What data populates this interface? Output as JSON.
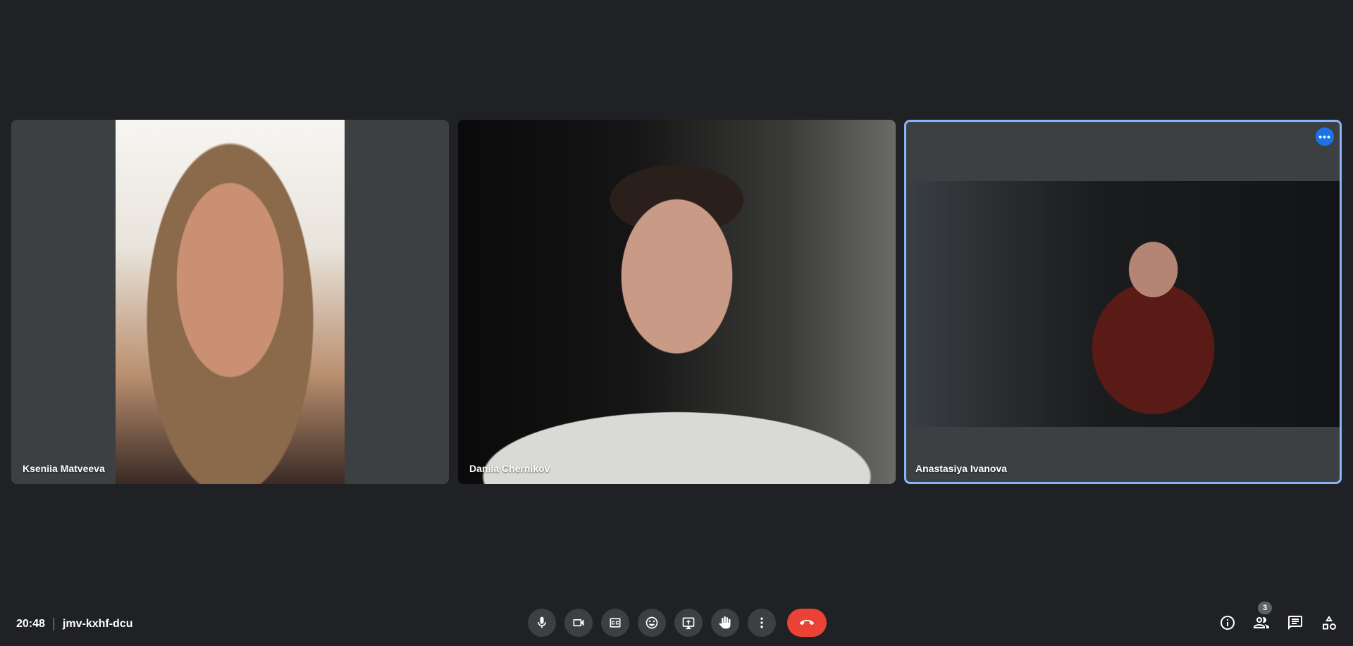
{
  "participants": [
    {
      "name": "Kseniia Matveeva"
    },
    {
      "name": "Danila Chernikov"
    },
    {
      "name": "Anastasiya Ivanova"
    }
  ],
  "meeting": {
    "time": "20:48",
    "code": "jmv-kxhf-dcu"
  },
  "people_count": "3",
  "tile_menu_glyph": "•••",
  "colors": {
    "background": "#202124",
    "tile": "#3c4043",
    "active_border": "#8ab4f8",
    "end_call": "#ea4335",
    "accent": "#1a73e8"
  },
  "icons": {
    "controls": [
      "mic-icon",
      "camera-icon",
      "captions-icon",
      "emoji-icon",
      "present-icon",
      "raise-hand-icon",
      "more-options-icon",
      "end-call-icon"
    ],
    "side": [
      "info-icon",
      "people-icon",
      "chat-icon",
      "activities-icon"
    ]
  }
}
